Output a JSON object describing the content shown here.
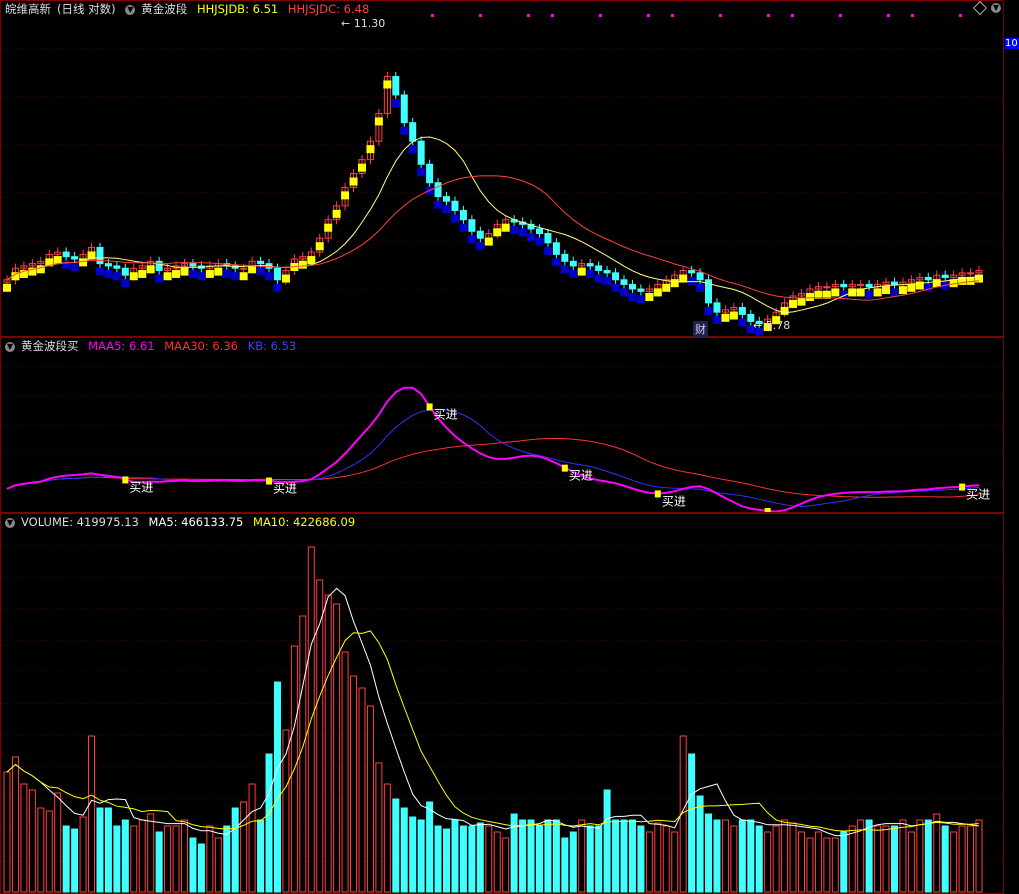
{
  "main_panel": {
    "stock_name": "皖维高新",
    "period_mode": "(日线 对数)",
    "indicator_name": "黄金波段",
    "hhjsjdb_label": "HHJSJDB: 6.51",
    "hhjsjdc_label": "HHJSJDC: 6.48",
    "high_marker": "11.30",
    "low_marker": "5.78",
    "event_badge": "财",
    "axis_top_label": "10"
  },
  "sub_panel": {
    "title": "黄金波段买",
    "maa5_label": "MAA5: 6.61",
    "maa30_label": "MAA30: 6.36",
    "kb_label": "KB: 6.53",
    "buy_label": "买进"
  },
  "volume_panel": {
    "volume_label": "VOLUME: 419975.13",
    "ma5_label": "MA5: 466133.75",
    "ma10_label": "MA10: 422686.09"
  },
  "colors": {
    "up": "#ff4040",
    "down": "#40ffff",
    "yellow_band": "#ffff00",
    "blue_band": "#0000cc",
    "maa5": "#ff00ff",
    "maa30": "#ff3030",
    "kb": "#3030ff",
    "ma5": "#ffffff",
    "ma10": "#ffff00"
  },
  "chart_data": {
    "type": "candlestick",
    "closes": [
      6.2,
      6.45,
      6.5,
      6.55,
      6.6,
      6.75,
      6.8,
      6.7,
      6.65,
      6.75,
      6.9,
      6.55,
      6.5,
      6.45,
      6.3,
      6.45,
      6.5,
      6.6,
      6.4,
      6.45,
      6.5,
      6.55,
      6.5,
      6.45,
      6.5,
      6.55,
      6.5,
      6.45,
      6.45,
      6.6,
      6.55,
      6.45,
      6.2,
      6.4,
      6.65,
      6.7,
      6.8,
      7.1,
      7.5,
      7.8,
      8.2,
      8.5,
      8.8,
      9.2,
      9.8,
      10.6,
      10.2,
      9.6,
      9.2,
      8.7,
      8.3,
      8.0,
      7.9,
      7.7,
      7.5,
      7.25,
      7.1,
      7.2,
      7.4,
      7.5,
      7.45,
      7.4,
      7.3,
      7.2,
      7.0,
      6.75,
      6.6,
      6.5,
      6.55,
      6.5,
      6.4,
      6.35,
      6.2,
      6.1,
      6.0,
      5.95,
      6.0,
      6.1,
      6.2,
      6.3,
      6.4,
      6.35,
      6.2,
      5.7,
      5.5,
      5.55,
      5.6,
      5.45,
      5.3,
      5.25,
      5.35,
      5.5,
      5.7,
      5.85,
      5.9,
      6.0,
      6.05,
      6.05,
      6.1,
      6.05,
      6.1,
      6.1,
      6.05,
      6.1,
      6.15,
      6.1,
      6.15,
      6.2,
      6.25,
      6.2,
      6.3,
      6.25,
      6.3,
      6.35,
      6.35,
      6.4
    ],
    "volumes": [
      40,
      45,
      36,
      34,
      28,
      27,
      33,
      22,
      21,
      25,
      52,
      28,
      28,
      22,
      24,
      22,
      24,
      26,
      20,
      22,
      22,
      24,
      18,
      16,
      22,
      18,
      22,
      28,
      30,
      36,
      24,
      46,
      70,
      54,
      82,
      92,
      115,
      104,
      99,
      96,
      80,
      72,
      68,
      62,
      43,
      36,
      31,
      28,
      25,
      24,
      30,
      22,
      21,
      24,
      22,
      22,
      23,
      22,
      20,
      18,
      26,
      24,
      24,
      22,
      24,
      24,
      18,
      20,
      24,
      22,
      22,
      34,
      24,
      24,
      24,
      22,
      20,
      23,
      22,
      20,
      52,
      46,
      32,
      26,
      24,
      24,
      22,
      24,
      24,
      22,
      20,
      22,
      24,
      23,
      20,
      18,
      20,
      18,
      18,
      20,
      22,
      24,
      24,
      22,
      22,
      22,
      24,
      20,
      24,
      24,
      26,
      22,
      20,
      22,
      22,
      24
    ],
    "ylim_price": [
      5.2,
      11.8
    ],
    "buy_signal_indices": [
      14,
      31,
      50,
      66,
      77,
      90,
      113
    ]
  }
}
